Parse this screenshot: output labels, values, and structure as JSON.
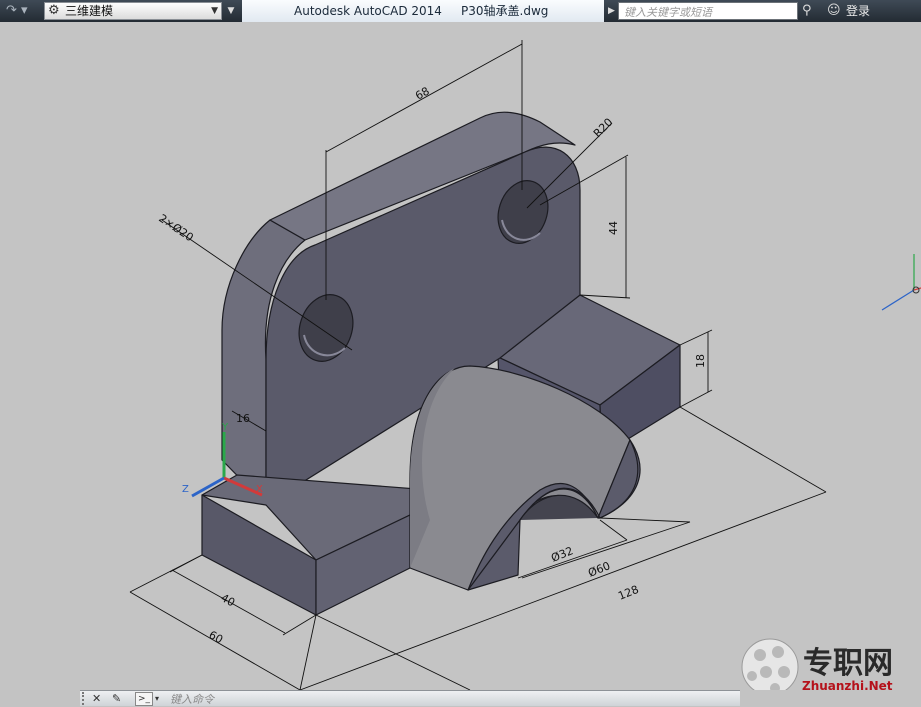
{
  "titlebar": {
    "workspace": "三维建模",
    "app_title": "Autodesk AutoCAD 2014",
    "doc_title": "P30轴承盖.dwg",
    "search_placeholder": "键入关键字或短语",
    "login": "登录"
  },
  "drawing": {
    "dimensions": {
      "width_68": "68",
      "radius": "R20",
      "holes": "2×Ø20",
      "height_44": "44",
      "thick_16": "16",
      "height_18": "18",
      "dia_32": "Ø32",
      "dia_60": "Ø60",
      "len_128": "128",
      "depth_40": "40",
      "depth_60": "60"
    },
    "ucs": {
      "y": "Y",
      "x": "X",
      "z": "Z"
    }
  },
  "watermark": {
    "cn": "专职网",
    "en": "Zhuanzhi.Net"
  },
  "command_line": {
    "placeholder": "键入命令"
  },
  "colors": {
    "solid_face": "#5e5e6c",
    "viewport": "#c4c4c4",
    "titlebar": "#2c343c"
  }
}
